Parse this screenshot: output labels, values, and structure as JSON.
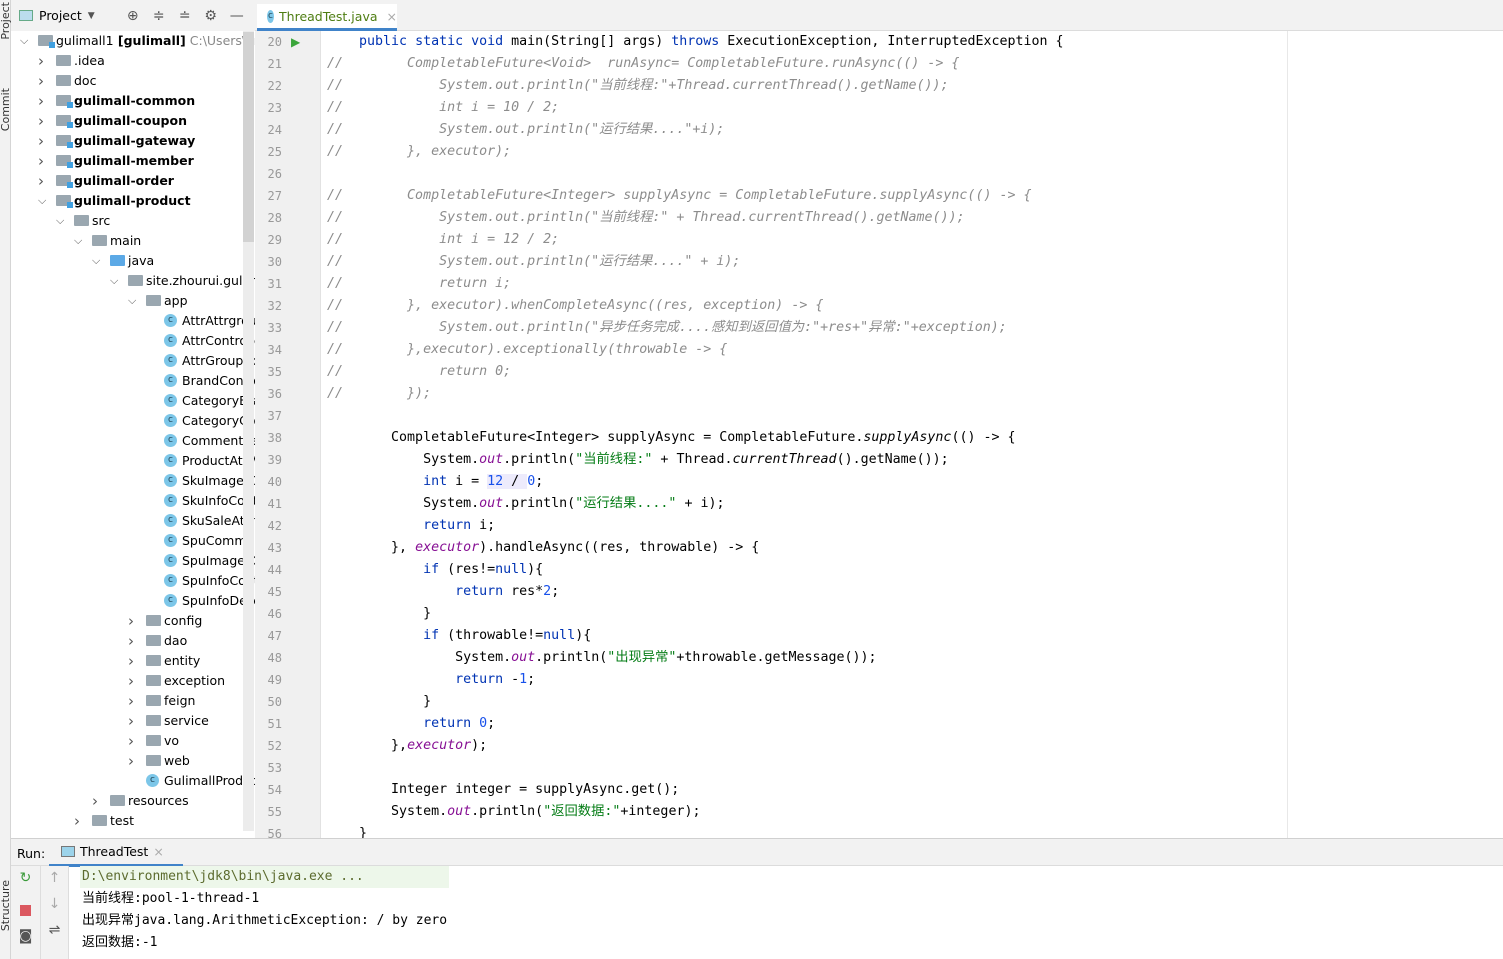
{
  "sidebar_tabs": {
    "project": "Project",
    "commit": "Commit",
    "structure": "Structure"
  },
  "project_panel": {
    "title": "Project",
    "icons": [
      "locate-icon",
      "expand-all-icon",
      "collapse-all-icon",
      "gear-icon",
      "minimize-icon"
    ]
  },
  "tree": [
    {
      "level": 0,
      "arrow": "open",
      "icon": "module",
      "label": "gulimall1",
      "bold_suffix": " [gulimall]",
      "path": "  C:\\Users\\eric"
    },
    {
      "level": 1,
      "arrow": "closed",
      "icon": "folder",
      "label": ".idea"
    },
    {
      "level": 1,
      "arrow": "closed",
      "icon": "folder",
      "label": "doc"
    },
    {
      "level": 1,
      "arrow": "closed",
      "icon": "module",
      "label": "gulimall-common",
      "bold": true
    },
    {
      "level": 1,
      "arrow": "closed",
      "icon": "module",
      "label": "gulimall-coupon",
      "bold": true
    },
    {
      "level": 1,
      "arrow": "closed",
      "icon": "module",
      "label": "gulimall-gateway",
      "bold": true
    },
    {
      "level": 1,
      "arrow": "closed",
      "icon": "module",
      "label": "gulimall-member",
      "bold": true
    },
    {
      "level": 1,
      "arrow": "closed",
      "icon": "module",
      "label": "gulimall-order",
      "bold": true
    },
    {
      "level": 1,
      "arrow": "open",
      "icon": "module",
      "label": "gulimall-product",
      "bold": true
    },
    {
      "level": 2,
      "arrow": "open",
      "icon": "folder",
      "label": "src"
    },
    {
      "level": 3,
      "arrow": "open",
      "icon": "folder",
      "label": "main"
    },
    {
      "level": 4,
      "arrow": "open",
      "icon": "source",
      "label": "java"
    },
    {
      "level": 5,
      "arrow": "open",
      "icon": "folder",
      "label": "site.zhourui.gulimall"
    },
    {
      "level": 6,
      "arrow": "open",
      "icon": "folder",
      "label": "app"
    },
    {
      "level": 7,
      "icon": "class",
      "label": "AttrAttrgroupRelationController"
    },
    {
      "level": 7,
      "icon": "class",
      "label": "AttrController"
    },
    {
      "level": 7,
      "icon": "class",
      "label": "AttrGroupController"
    },
    {
      "level": 7,
      "icon": "class",
      "label": "BrandController"
    },
    {
      "level": 7,
      "icon": "class",
      "label": "CategoryBrandRelationController"
    },
    {
      "level": 7,
      "icon": "class",
      "label": "CategoryController"
    },
    {
      "level": 7,
      "icon": "class",
      "label": "CommentReplayController"
    },
    {
      "level": 7,
      "icon": "class",
      "label": "ProductAttrValueController"
    },
    {
      "level": 7,
      "icon": "class",
      "label": "SkuImagesController"
    },
    {
      "level": 7,
      "icon": "class",
      "label": "SkuInfoController"
    },
    {
      "level": 7,
      "icon": "class",
      "label": "SkuSaleAttrValueController"
    },
    {
      "level": 7,
      "icon": "class",
      "label": "SpuCommentController"
    },
    {
      "level": 7,
      "icon": "class",
      "label": "SpuImagesController"
    },
    {
      "level": 7,
      "icon": "class",
      "label": "SpuInfoController"
    },
    {
      "level": 7,
      "icon": "class",
      "label": "SpuInfoDescController"
    },
    {
      "level": 6,
      "arrow": "closed",
      "icon": "folder",
      "label": "config"
    },
    {
      "level": 6,
      "arrow": "closed",
      "icon": "folder",
      "label": "dao"
    },
    {
      "level": 6,
      "arrow": "closed",
      "icon": "folder",
      "label": "entity"
    },
    {
      "level": 6,
      "arrow": "closed",
      "icon": "folder",
      "label": "exception"
    },
    {
      "level": 6,
      "arrow": "closed",
      "icon": "folder",
      "label": "feign"
    },
    {
      "level": 6,
      "arrow": "closed",
      "icon": "folder",
      "label": "service"
    },
    {
      "level": 6,
      "arrow": "closed",
      "icon": "folder",
      "label": "vo"
    },
    {
      "level": 6,
      "arrow": "closed",
      "icon": "folder",
      "label": "web"
    },
    {
      "level": 6,
      "icon": "class",
      "label": "GulimallProductApplication"
    },
    {
      "level": 4,
      "arrow": "closed",
      "icon": "folder",
      "label": "resources"
    },
    {
      "level": 3,
      "arrow": "closed",
      "icon": "folder",
      "label": "test"
    }
  ],
  "editor": {
    "tab": {
      "label": "ThreadTest.java"
    },
    "lines": [
      {
        "n": "20",
        "run": true,
        "t": [
          [
            "    ",
            ""
          ],
          [
            "public static void ",
            "kw"
          ],
          [
            "main(String[] args) ",
            ""
          ],
          [
            "throws ",
            "kw"
          ],
          [
            "ExecutionException, InterruptedException {",
            ""
          ]
        ]
      },
      {
        "n": "21",
        "t": [
          [
            "//        CompletableFuture<Void>  runAsync= CompletableFuture.runAsync(() -> {",
            "cm"
          ]
        ]
      },
      {
        "n": "22",
        "t": [
          [
            "//            System.out.println(\"当前线程:\"+Thread.currentThread().getName());",
            "cm"
          ]
        ]
      },
      {
        "n": "23",
        "t": [
          [
            "//            int i = 10 / 2;",
            "cm"
          ]
        ]
      },
      {
        "n": "24",
        "t": [
          [
            "//            System.out.println(\"运行结果....\"+i);",
            "cm"
          ]
        ]
      },
      {
        "n": "25",
        "t": [
          [
            "//        }, executor);",
            "cm"
          ]
        ]
      },
      {
        "n": "26",
        "t": []
      },
      {
        "n": "27",
        "t": [
          [
            "//        CompletableFuture<Integer> supplyAsync = CompletableFuture.supplyAsync(() -> {",
            "cm"
          ]
        ]
      },
      {
        "n": "28",
        "t": [
          [
            "//            System.out.println(\"当前线程:\" + Thread.currentThread().getName());",
            "cm"
          ]
        ]
      },
      {
        "n": "29",
        "t": [
          [
            "//            int i = 12 / 2;",
            "cm"
          ]
        ]
      },
      {
        "n": "30",
        "t": [
          [
            "//            System.out.println(\"运行结果....\" + i);",
            "cm"
          ]
        ]
      },
      {
        "n": "31",
        "t": [
          [
            "//            return i;",
            "cm"
          ]
        ]
      },
      {
        "n": "32",
        "t": [
          [
            "//        }, executor).whenCompleteAsync((res, exception) -> {",
            "cm"
          ]
        ]
      },
      {
        "n": "33",
        "t": [
          [
            "//            System.out.println(\"异步任务完成....感知到返回值为:\"+res+\"异常:\"+exception);",
            "cm"
          ]
        ]
      },
      {
        "n": "34",
        "t": [
          [
            "//        },executor).exceptionally(throwable -> {",
            "cm"
          ]
        ]
      },
      {
        "n": "35",
        "t": [
          [
            "//            return 0;",
            "cm"
          ]
        ]
      },
      {
        "n": "36",
        "t": [
          [
            "//        });",
            "cm"
          ]
        ]
      },
      {
        "n": "37",
        "t": []
      },
      {
        "n": "38",
        "t": [
          [
            "        CompletableFuture<Integer> supplyAsync = CompletableFuture.",
            ""
          ],
          [
            "supplyAsync",
            "it"
          ],
          [
            "(() -> {",
            ""
          ]
        ]
      },
      {
        "n": "39",
        "t": [
          [
            "            System.",
            ""
          ],
          [
            "out",
            "fld"
          ],
          [
            ".println(",
            ""
          ],
          [
            "\"当前线程:\"",
            "str"
          ],
          [
            " + Thread.",
            ""
          ],
          [
            "currentThread",
            "it"
          ],
          [
            "().getName());",
            ""
          ]
        ]
      },
      {
        "n": "40",
        "t": [
          [
            "            ",
            ""
          ],
          [
            "int",
            "kw"
          ],
          [
            " i = ",
            ""
          ],
          [
            "12",
            "num hl"
          ],
          [
            " / ",
            "hl"
          ],
          [
            "0",
            "num"
          ],
          [
            ";",
            ""
          ]
        ]
      },
      {
        "n": "41",
        "t": [
          [
            "            System.",
            ""
          ],
          [
            "out",
            "fld"
          ],
          [
            ".println(",
            ""
          ],
          [
            "\"运行结果....\"",
            "str"
          ],
          [
            " + i);",
            ""
          ]
        ]
      },
      {
        "n": "42",
        "t": [
          [
            "            ",
            ""
          ],
          [
            "return",
            "kw"
          ],
          [
            " i;",
            ""
          ]
        ]
      },
      {
        "n": "43",
        "t": [
          [
            "        }, ",
            ""
          ],
          [
            "executor",
            "fld"
          ],
          [
            ").handleAsync((res, throwable) -> {",
            ""
          ]
        ]
      },
      {
        "n": "44",
        "t": [
          [
            "            ",
            ""
          ],
          [
            "if",
            "kw"
          ],
          [
            " (res!=",
            ""
          ],
          [
            "null",
            "kw"
          ],
          [
            "){",
            ""
          ]
        ]
      },
      {
        "n": "45",
        "t": [
          [
            "                ",
            ""
          ],
          [
            "return",
            "kw"
          ],
          [
            " res*",
            ""
          ],
          [
            "2",
            "num"
          ],
          [
            ";",
            ""
          ]
        ]
      },
      {
        "n": "46",
        "t": [
          [
            "            }",
            ""
          ]
        ]
      },
      {
        "n": "47",
        "t": [
          [
            "            ",
            ""
          ],
          [
            "if",
            "kw"
          ],
          [
            " (throwable!=",
            ""
          ],
          [
            "null",
            "kw"
          ],
          [
            "){",
            ""
          ]
        ]
      },
      {
        "n": "48",
        "t": [
          [
            "                System.",
            ""
          ],
          [
            "out",
            "fld"
          ],
          [
            ".println(",
            ""
          ],
          [
            "\"出现异常\"",
            "str"
          ],
          [
            "+throwable.getMessage());",
            ""
          ]
        ]
      },
      {
        "n": "49",
        "t": [
          [
            "                ",
            ""
          ],
          [
            "return",
            "kw"
          ],
          [
            " -",
            ""
          ],
          [
            "1",
            "num"
          ],
          [
            ";",
            ""
          ]
        ]
      },
      {
        "n": "50",
        "t": [
          [
            "            }",
            ""
          ]
        ]
      },
      {
        "n": "51",
        "t": [
          [
            "            ",
            ""
          ],
          [
            "return",
            "kw"
          ],
          [
            " ",
            ""
          ],
          [
            "0",
            "num"
          ],
          [
            ";",
            ""
          ]
        ]
      },
      {
        "n": "52",
        "t": [
          [
            "        },",
            ""
          ],
          [
            "executor",
            "fld"
          ],
          [
            ");",
            ""
          ]
        ]
      },
      {
        "n": "53",
        "t": []
      },
      {
        "n": "54",
        "t": [
          [
            "        Integer integer = supplyAsync.get();",
            ""
          ]
        ]
      },
      {
        "n": "55",
        "t": [
          [
            "        System.",
            ""
          ],
          [
            "out",
            "fld"
          ],
          [
            ".println(",
            ""
          ],
          [
            "\"返回数据:\"",
            "str"
          ],
          [
            "+integer);",
            ""
          ]
        ]
      },
      {
        "n": "56",
        "t": [
          [
            "    }",
            ""
          ]
        ]
      }
    ]
  },
  "run": {
    "label": "Run:",
    "tab": "ThreadTest",
    "output": [
      {
        "text": "D:\\environment\\jdk8\\bin\\java.exe ...",
        "kind": "cmd"
      },
      {
        "text": "当前线程:pool-1-thread-1"
      },
      {
        "text": "出现异常java.lang.ArithmeticException: / by zero"
      },
      {
        "text": "返回数据:-1"
      }
    ]
  },
  "colors": {
    "keyword": "#0033b3",
    "string": "#067d17",
    "number": "#1750eb",
    "field": "#871094",
    "comment": "#8c8c8c",
    "accent": "#4083c9"
  }
}
